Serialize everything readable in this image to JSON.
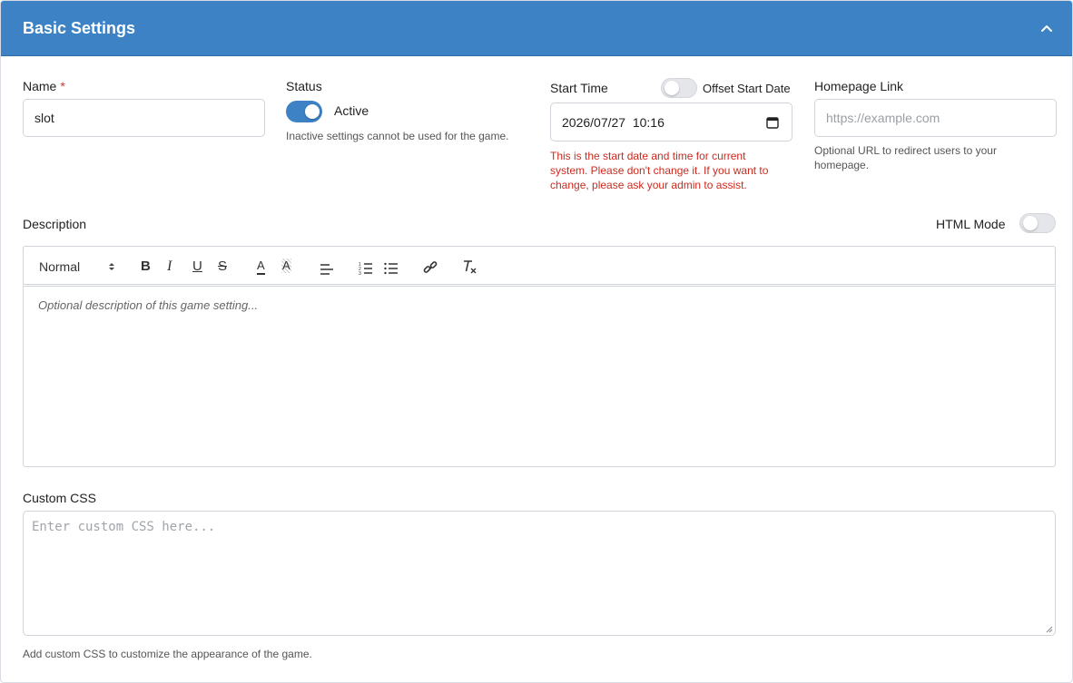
{
  "header": {
    "title": "Basic Settings",
    "collapse_icon": "chevron-up-icon",
    "bg_color": "#3d82c4"
  },
  "name_field": {
    "label": "Name",
    "required_mark": "*",
    "value": "slot"
  },
  "status": {
    "label": "Status",
    "toggle_on": true,
    "toggle_label": "Active",
    "help": "Inactive settings cannot be used for the game."
  },
  "start_time": {
    "label": "Start Time",
    "offset_toggle_on": false,
    "offset_label": "Offset Start Date",
    "value": "2026/07/27  10:16",
    "calendar_icon": "calendar-icon",
    "warning_lines": [
      "This is the start date and time for current",
      "system. Please don't change it. If you want to",
      "change, please ask your admin to assist."
    ]
  },
  "homepage": {
    "label": "Homepage Link",
    "placeholder": "https://example.com",
    "help_lines": [
      "Optional URL to redirect users to your",
      "homepage."
    ]
  },
  "description": {
    "label": "Description",
    "html_mode_label": "HTML Mode",
    "html_mode_on": false,
    "placeholder": "Optional description of this game setting...",
    "toolbar": {
      "format_select": "Normal",
      "buttons": [
        "bold",
        "italic",
        "underline",
        "strike",
        "font-color",
        "background-color",
        "align",
        "ordered-list",
        "bullet-list",
        "link",
        "clear-format"
      ],
      "bold_glyph": "B",
      "italic_glyph": "I",
      "underline_glyph": "U",
      "strike_glyph": "S",
      "color_glyph": "A",
      "bg_glyph": "A"
    }
  },
  "custom_css": {
    "label": "Custom CSS",
    "placeholder": "Enter custom CSS here...",
    "help": "Add custom CSS to customize the appearance of the game."
  }
}
